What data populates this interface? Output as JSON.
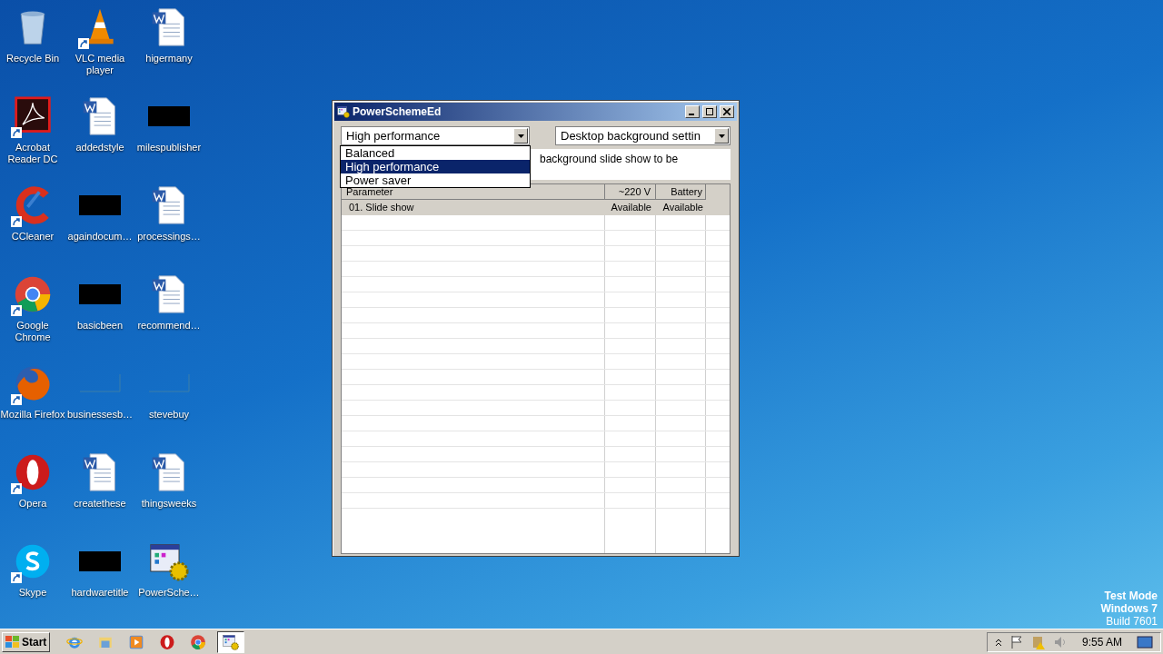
{
  "desktop_icons": [
    {
      "label": "Recycle Bin",
      "kind": "recycle",
      "shortcut": false
    },
    {
      "label": "VLC media player",
      "kind": "vlc",
      "shortcut": true
    },
    {
      "label": "higermany",
      "kind": "word",
      "shortcut": false
    },
    {
      "label": "Acrobat Reader DC",
      "kind": "acrobat",
      "shortcut": true
    },
    {
      "label": "addedstyle",
      "kind": "word",
      "shortcut": false
    },
    {
      "label": "milespublisher",
      "kind": "redacted",
      "shortcut": false
    },
    {
      "label": "CCleaner",
      "kind": "ccleaner",
      "shortcut": true
    },
    {
      "label": "againdocum…",
      "kind": "redacted",
      "shortcut": false
    },
    {
      "label": "processings…",
      "kind": "word",
      "shortcut": false
    },
    {
      "label": "Google Chrome",
      "kind": "chrome",
      "shortcut": true
    },
    {
      "label": "basicbeen",
      "kind": "redacted",
      "shortcut": false
    },
    {
      "label": "recommend…",
      "kind": "word",
      "shortcut": false
    },
    {
      "label": "Mozilla Firefox",
      "kind": "firefox",
      "shortcut": true
    },
    {
      "label": "businessesb…",
      "kind": "blank",
      "shortcut": false
    },
    {
      "label": "stevebuy",
      "kind": "blank",
      "shortcut": false
    },
    {
      "label": "Opera",
      "kind": "opera",
      "shortcut": true
    },
    {
      "label": "createthese",
      "kind": "word",
      "shortcut": false
    },
    {
      "label": "thingsweeks",
      "kind": "word",
      "shortcut": false
    },
    {
      "label": "Skype",
      "kind": "skype",
      "shortcut": true
    },
    {
      "label": "hardwaretitle",
      "kind": "redacted",
      "shortcut": false
    },
    {
      "label": "PowerSche…",
      "kind": "app",
      "shortcut": false
    }
  ],
  "window": {
    "title": "PowerSchemeEd",
    "scheme_combo": {
      "value": "High performance",
      "options": [
        {
          "label": "Balanced",
          "selected": false
        },
        {
          "label": "High performance",
          "selected": true
        },
        {
          "label": "Power saver",
          "selected": false
        }
      ]
    },
    "setting_combo": {
      "value": "Desktop background settin"
    },
    "description": "background slide show to be",
    "table": {
      "columns": [
        "Parameter",
        "~220 V",
        "Battery"
      ],
      "rows": [
        {
          "cells": [
            "01. Slide show",
            "Available",
            "Available"
          ],
          "selected": true
        }
      ]
    }
  },
  "watermark_text": [
    "Test Mode",
    "Windows 7",
    "Build 7601"
  ],
  "taskbar": {
    "start": "Start",
    "items": [
      {
        "kind": "ie",
        "selected": false
      },
      {
        "kind": "explorer",
        "selected": false
      },
      {
        "kind": "media",
        "selected": false
      },
      {
        "kind": "opera",
        "selected": false
      },
      {
        "kind": "chrome",
        "selected": false
      },
      {
        "kind": "app",
        "selected": true
      }
    ],
    "time": "9:55 AM"
  }
}
